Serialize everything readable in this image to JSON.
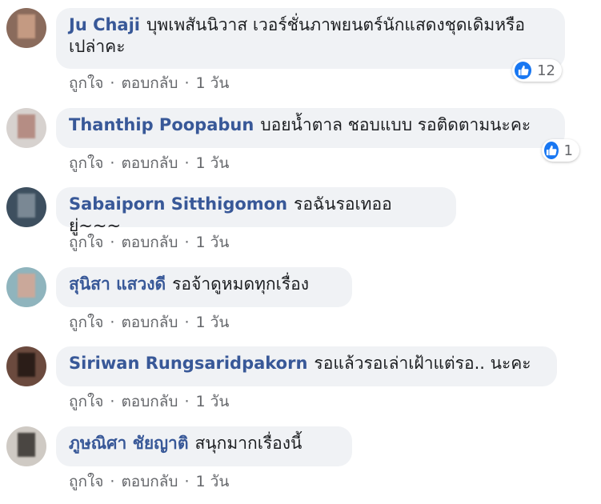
{
  "comments": [
    {
      "author": "Ju Chaji",
      "text": "บุพเพสันนิวาส เวอร์ชั่นภาพยนตร์นักแสดงชุดเดิมหรือเปล่าคะ",
      "like": "ถูกใจ",
      "reply": "ตอบกลับ",
      "time": "1 วัน",
      "reaction_count": "12"
    },
    {
      "author": "Thanthip Poopabun",
      "text": "บอยน้ำตาล ชอบแบบ รอติดตามนะคะ",
      "like": "ถูกใจ",
      "reply": "ตอบกลับ",
      "time": "1 วัน",
      "reaction_count": "1"
    },
    {
      "author": "Sabaiporn Sitthigomon",
      "text": "รอฉันรอเทออยู่~~~",
      "like": "ถูกใจ",
      "reply": "ตอบกลับ",
      "time": "1 วัน"
    },
    {
      "author": "สุนิสา แสวงดี",
      "text": "รอจ้าดูหมดทุกเรื่อง",
      "like": "ถูกใจ",
      "reply": "ตอบกลับ",
      "time": "1 วัน"
    },
    {
      "author": "Siriwan Rungsaridpakorn",
      "text": "รอแล้วรอเล่าเฝ้าแต่รอ.. นะคะ",
      "like": "ถูกใจ",
      "reply": "ตอบกลับ",
      "time": "1 วัน"
    },
    {
      "author": "ภูษณิศา ชัยญาติ",
      "text": "สนุกมากเรื่องนี้",
      "like": "ถูกใจ",
      "reply": "ตอบกลับ",
      "time": "1 วัน"
    }
  ],
  "separator": "·",
  "colors": {
    "author": "#385898",
    "bubble": "#f0f2f5",
    "meta": "#65676b",
    "like_icon": "#1877f2"
  },
  "icons": {
    "reaction": "thumbs-up-icon",
    "avatar": "blurred-profile-photo"
  }
}
